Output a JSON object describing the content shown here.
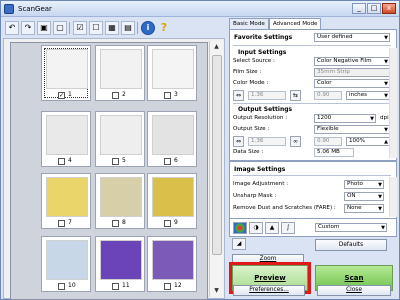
{
  "window": {
    "title": "ScanGear",
    "minimize": "_",
    "maximize": "□",
    "close": "x"
  },
  "toolbar": {
    "info": "i",
    "help": "?"
  },
  "thumbnails": [
    {
      "num": "1",
      "checked": true,
      "selected": true,
      "fill": "#f3f3f3"
    },
    {
      "num": "2",
      "checked": false,
      "selected": false,
      "fill": "#f2f2f2"
    },
    {
      "num": "3",
      "checked": false,
      "selected": false,
      "fill": "#f4f4f4"
    },
    {
      "num": "4",
      "checked": false,
      "selected": false,
      "fill": "#e9e9e9"
    },
    {
      "num": "5",
      "checked": false,
      "selected": false,
      "fill": "#eeeeee"
    },
    {
      "num": "6",
      "checked": false,
      "selected": false,
      "fill": "#e3e3e3"
    },
    {
      "num": "7",
      "checked": false,
      "selected": false,
      "fill": "#e9d56a"
    },
    {
      "num": "8",
      "checked": false,
      "selected": false,
      "fill": "#d6cfa8"
    },
    {
      "num": "9",
      "checked": false,
      "selected": false,
      "fill": "#d8c04a"
    },
    {
      "num": "10",
      "checked": false,
      "selected": false,
      "fill": "#c8d7e8"
    },
    {
      "num": "11",
      "checked": false,
      "selected": false,
      "fill": "#6a44b8"
    },
    {
      "num": "12",
      "checked": false,
      "selected": false,
      "fill": "#7c5ab8"
    }
  ],
  "tabs": [
    "Basic Mode",
    "Advanced Mode"
  ],
  "favorite": {
    "label": "Favorite Settings",
    "value": "User defined"
  },
  "input_settings": {
    "header": "Input Settings",
    "select_source_label": "Select Source :",
    "select_source": "Color Negative Film",
    "film_size_label": "Film Size :",
    "film_size": "35mm Strip",
    "color_mode_label": "Color Mode :",
    "color_mode": "Color",
    "dim1": "1.36",
    "dim2": "0.90",
    "unit": "inches"
  },
  "output_settings": {
    "header": "Output Settings",
    "resolution_label": "Output Resolution :",
    "resolution": "1200",
    "dpi": "dpi",
    "size_label": "Output Size :",
    "size": "Flexible",
    "dim1": "1.36",
    "dim2": "0.90",
    "scale": "100%",
    "data_size_label": "Data Size :",
    "data_size": "5.06 MB"
  },
  "image_settings": {
    "header": "Image Settings",
    "adjustment_label": "Image Adjustment :",
    "adjustment": "Photo",
    "unsharp_label": "Unsharp Mask :",
    "unsharp": "ON",
    "dust_label": "Remove Dust and Scratches (FARE) :",
    "dust": "None"
  },
  "tone": {
    "custom": "Custom",
    "defaults": "Defaults"
  },
  "buttons": {
    "zoom": "Zoom",
    "preview": "Preview",
    "scan": "Scan",
    "preferences": "Preferences...",
    "close": "Close"
  },
  "colors": {
    "highlight": "#e01818",
    "scan_green": "#7fce5a",
    "preview_green": "#b9e6a0"
  }
}
